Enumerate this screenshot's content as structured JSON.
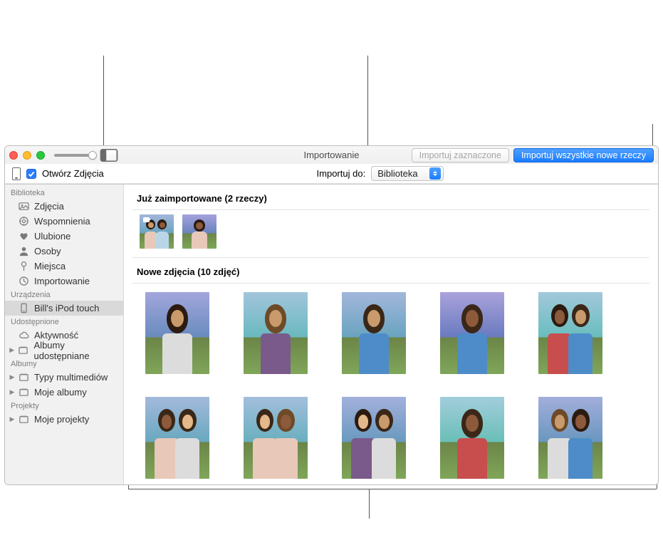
{
  "callouts": {},
  "window": {
    "title": "Importowanie",
    "toolbar": {
      "import_selected_label": "Importuj zaznaczone",
      "import_all_label": "Importuj wszystkie nowe rzeczy"
    },
    "subbar": {
      "open_photos_label": "Otwórz Zdjęcia",
      "open_photos_checked": true,
      "import_to_label": "Importuj do:",
      "import_to_value": "Biblioteka"
    }
  },
  "sidebar": {
    "sections": [
      {
        "header": "Biblioteka",
        "items": [
          {
            "id": "photos",
            "label": "Zdjęcia",
            "icon": "photos"
          },
          {
            "id": "memories",
            "label": "Wspomnienia",
            "icon": "memories"
          },
          {
            "id": "favorites",
            "label": "Ulubione",
            "icon": "heart"
          },
          {
            "id": "people",
            "label": "Osoby",
            "icon": "person"
          },
          {
            "id": "places",
            "label": "Miejsca",
            "icon": "pin"
          },
          {
            "id": "import",
            "label": "Importowanie",
            "icon": "clock"
          }
        ]
      },
      {
        "header": "Urządzenia",
        "items": [
          {
            "id": "device-ipod",
            "label": "Bill's iPod touch",
            "icon": "device",
            "selected": true
          }
        ]
      },
      {
        "header": "Udostępnione",
        "items": [
          {
            "id": "activity",
            "label": "Aktywność",
            "icon": "cloud"
          },
          {
            "id": "shared-albums",
            "label": "Albumy udostępniane",
            "icon": "album",
            "disclose": true
          }
        ]
      },
      {
        "header": "Albumy",
        "items": [
          {
            "id": "media-types",
            "label": "Typy multimediów",
            "icon": "album",
            "disclose": true
          },
          {
            "id": "my-albums",
            "label": "Moje albumy",
            "icon": "album",
            "disclose": true
          }
        ]
      },
      {
        "header": "Projekty",
        "items": [
          {
            "id": "my-projects",
            "label": "Moje projekty",
            "icon": "album",
            "disclose": true
          }
        ]
      }
    ]
  },
  "content": {
    "already": {
      "title": "Już zaimportowane (2 rzeczy)",
      "items": [
        {
          "video": true
        },
        {
          "video": false
        }
      ]
    },
    "newphotos": {
      "title": "Nowe zdjęcia (10 zdjęć)",
      "count": 10
    }
  }
}
